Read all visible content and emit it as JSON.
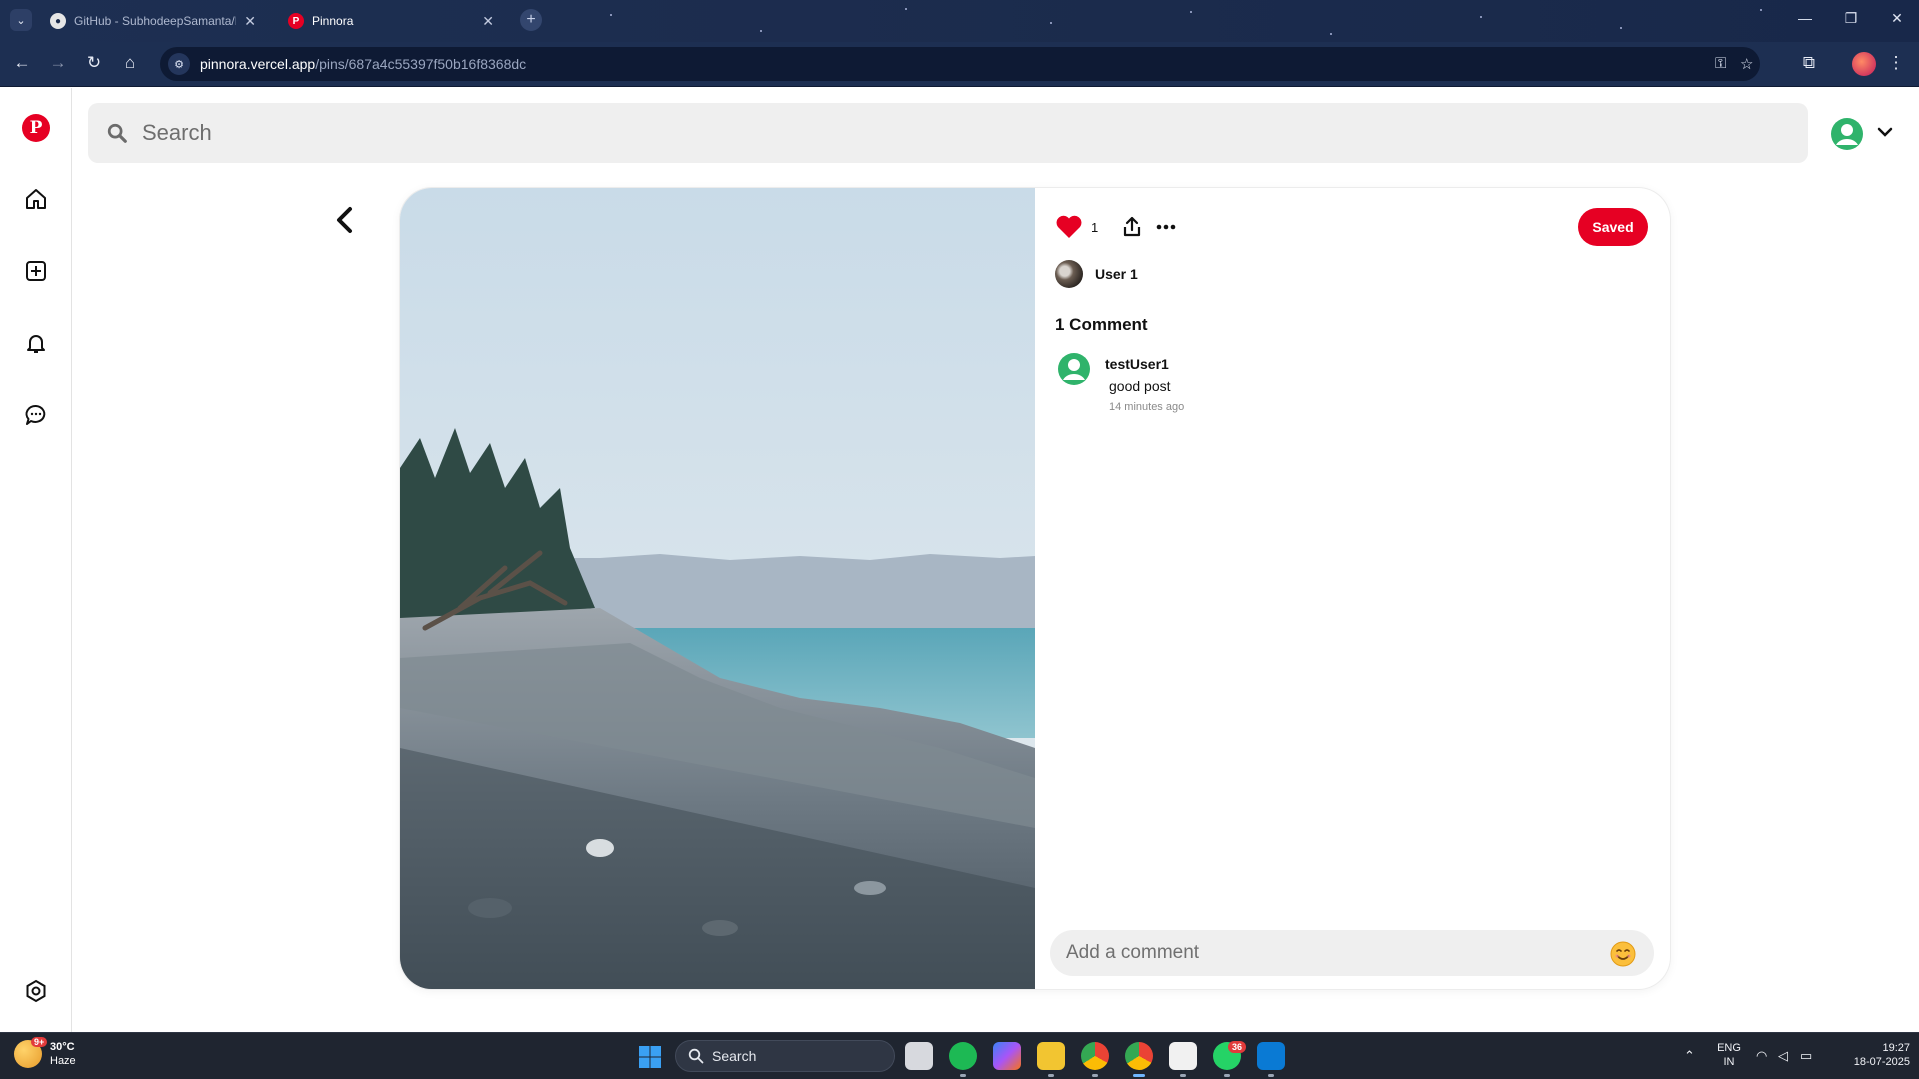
{
  "browser": {
    "tabs": [
      {
        "title": "GitHub - SubhodeepSamanta/P",
        "favicon": "github-icon",
        "active": false
      },
      {
        "title": "Pinnora",
        "favicon": "pinnora-logo-icon",
        "active": true
      }
    ],
    "url_host": "pinnora.vercel.app",
    "url_path": "/pins/687a4c55397f50b16f8368dc"
  },
  "app": {
    "logo": "P",
    "search_placeholder": "Search",
    "sidebar": [
      "home-icon",
      "create-icon",
      "notifications-icon",
      "messages-icon",
      "settings-icon"
    ],
    "pin": {
      "likes": "1",
      "saved_label": "Saved",
      "author": "User 1",
      "comments_heading": "1 Comment",
      "comments": [
        {
          "user": "testUser1",
          "text": "good post",
          "time": "14 minutes ago"
        }
      ],
      "comment_placeholder": "Add a comment",
      "accent": "#e60023"
    }
  },
  "taskbar": {
    "weather_temp": "30°C",
    "weather_desc": "Haze",
    "weather_badge": "9+",
    "search_label": "Search",
    "whatsapp_badge": "36",
    "lang_top": "ENG",
    "lang_bottom": "IN",
    "time": "19:27",
    "date": "18-07-2025"
  }
}
